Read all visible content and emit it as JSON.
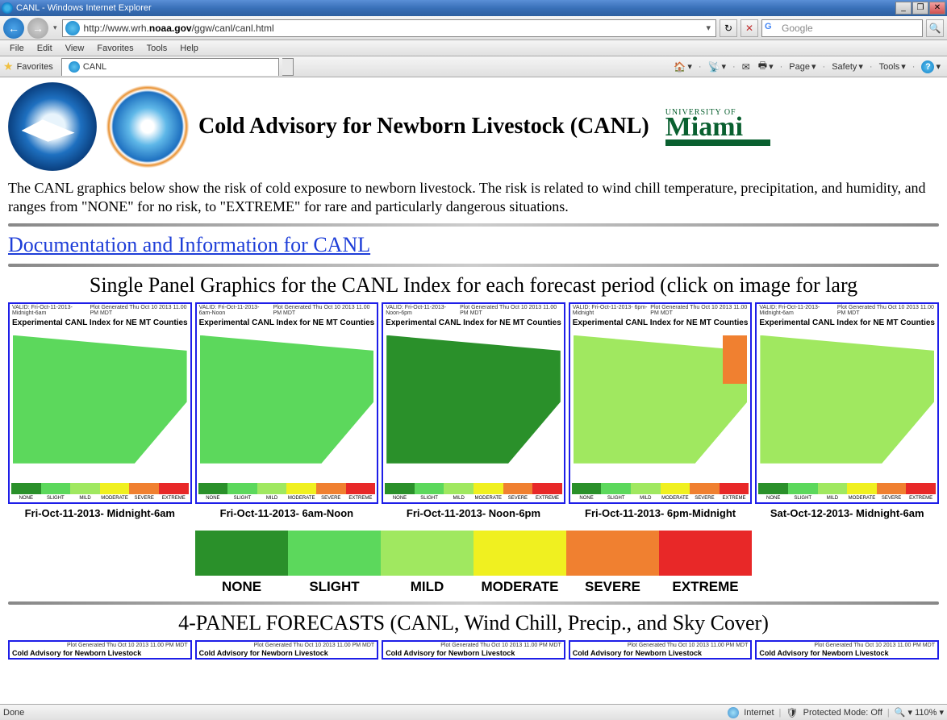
{
  "titlebar": {
    "title": "CANL - Windows Internet Explorer"
  },
  "url": {
    "prefix": "http://www.wrh.",
    "bold": "noaa.gov",
    "suffix": "/ggw/canl/canl.html"
  },
  "search": {
    "placeholder": "Google"
  },
  "menubar": [
    "File",
    "Edit",
    "View",
    "Favorites",
    "Tools",
    "Help"
  ],
  "favorites_label": "Favorites",
  "tab": {
    "title": "CANL"
  },
  "toolbar_right": {
    "page": "Page",
    "safety": "Safety",
    "tools": "Tools"
  },
  "page": {
    "title": "Cold Advisory for Newborn Livestock (CANL)",
    "um_top": "UNIVERSITY OF",
    "um_main": "Miami",
    "intro": "The CANL graphics below show the risk of cold exposure to newborn livestock. The risk is related to wind chill temperature, precipitation, and humidity, and ranges from \"NONE\" for no risk, to \"EXTREME\" for rare and particularly dangerous situations.",
    "doc_link": "Documentation and Information for CANL",
    "single_title": "Single Panel Graphics for the CANL Index for each forecast period (click on image for larg",
    "four_panel_title": "4-PANEL FORECASTS (CANL, Wind Chill, Precip., and Sky Cover)",
    "panel_exp_title": "Experimental CANL Index for NE MT Counties",
    "panel_valid_prefix": "VALID: Fri-Oct-11-2013-",
    "panel_gen": "Plot Generated Thu Oct 10 2013 11.00 PM MDT",
    "legend_labels": [
      "NONE",
      "SLIGHT",
      "MILD",
      "MODERATE",
      "SEVERE",
      "EXTREME"
    ],
    "panels": [
      {
        "valid": "Midnight-6am",
        "caption": "Fri-Oct-11-2013- Midnight-6am",
        "style": "green"
      },
      {
        "valid": "6am-Noon",
        "caption": "Fri-Oct-11-2013-    6am-Noon",
        "style": "mixed"
      },
      {
        "valid": "Noon-6pm",
        "caption": "Fri-Oct-11-2013-      Noon-6pm",
        "style": "dark"
      },
      {
        "valid": "6pm-Midnight",
        "caption": "Fri-Oct-11-2013- 6pm-Midnight",
        "style": "light_orange"
      },
      {
        "valid": "Midnight-6am",
        "caption": "Sat-Oct-12-2013- Midnight-6am",
        "style": "light"
      }
    ],
    "panel4_title": "Cold Advisory for Newborn Livestock",
    "panel4_gen": "Plot Generated Thu Oct 10 2013 11.00 PM MDT"
  },
  "statusbar": {
    "left": "Done",
    "zone": "Internet",
    "protected": "Protected Mode: Off",
    "zoom": "110%"
  }
}
